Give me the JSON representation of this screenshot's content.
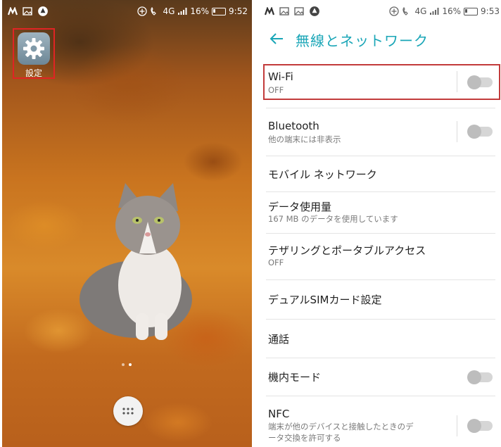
{
  "colors": {
    "accent": "#1aa6b7",
    "highlight": "#c23b3b",
    "toggle_off_track": "#d6d6d6",
    "toggle_off_knob": "#bdbdbd"
  },
  "home_screen": {
    "status_bar": {
      "left_icons": [
        "m-icon",
        "gallery-icon",
        "sync-icon"
      ],
      "network_type": "4G",
      "battery": "16%",
      "time": "9:52"
    },
    "settings_shortcut": {
      "icon": "gear-icon",
      "label": "設定"
    },
    "page_indicator": {
      "pages": 2,
      "current": 2
    },
    "app_drawer_icon": "apps-icon"
  },
  "settings_screen": {
    "status_bar": {
      "left_icons": [
        "m-icon",
        "gallery-icon",
        "gallery-icon",
        "sync-icon"
      ],
      "network_type": "4G",
      "battery": "16%",
      "time": "9:53"
    },
    "title": "無線とネットワーク",
    "items": [
      {
        "label": "Wi-Fi",
        "sub": "OFF",
        "toggle": false,
        "highlighted": true
      },
      {
        "label": "Bluetooth",
        "sub": "他の端末には非表示",
        "toggle": false
      },
      {
        "label": "モバイル ネットワーク"
      },
      {
        "label": "データ使用量",
        "sub": "167 MB のデータを使用しています"
      },
      {
        "label": "テザリングとポータブルアクセス",
        "sub": "OFF"
      },
      {
        "label": "デュアルSIMカード設定"
      },
      {
        "label": "通話"
      },
      {
        "label": "機内モード",
        "toggle": false
      },
      {
        "label": "NFC",
        "sub_line1": "端末が他のデバイスと接触したときのデ",
        "sub_line2": "ータ交換を許可する",
        "toggle": false
      }
    ]
  }
}
